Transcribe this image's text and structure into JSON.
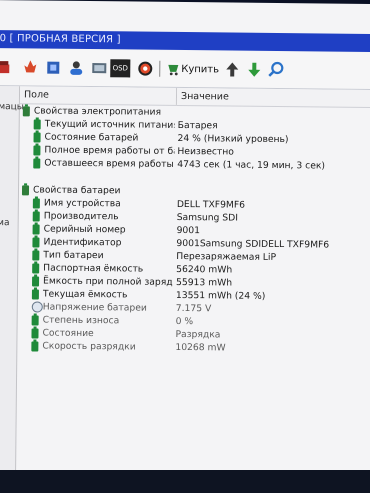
{
  "window": {
    "title": "[ ПРОБНАЯ ВЕРСИЯ ]",
    "title_prefix": "0"
  },
  "toolbar": {
    "buy_label": "Купить",
    "icons": [
      "report-icon",
      "flame-icon",
      "benchmark-icon",
      "user-icon",
      "module-icon",
      "osd-icon",
      "gauge-icon",
      "cart-icon",
      "up-arrow-icon",
      "down-arrow-icon",
      "search-icon"
    ],
    "osd_text": "OSD"
  },
  "left_pane": {
    "items": [
      "омацы",
      "ема"
    ]
  },
  "columns": {
    "field": "Поле",
    "value": "Значение"
  },
  "power_section": {
    "title": "Свойства электропитания",
    "rows": [
      {
        "field": "Текущий источник питания",
        "value": "Батарея"
      },
      {
        "field": "Состояние батарей",
        "value": "24 % (Низкий уровень)"
      },
      {
        "field": "Полное время работы от бата...",
        "value": "Неизвестно"
      },
      {
        "field": "Оставшееся время работы от ...",
        "value": "4743 сек (1 час, 19 мин, 3 сек)"
      }
    ]
  },
  "battery_section": {
    "title": "Свойства батареи",
    "rows": [
      {
        "field": "Имя устройства",
        "value": "DELL TXF9MF6"
      },
      {
        "field": "Производитель",
        "value": "Samsung SDI"
      },
      {
        "field": "Серийный номер",
        "value": "9001"
      },
      {
        "field": "Идентификатор",
        "value": "9001Samsung SDIDELL TXF9MF6"
      },
      {
        "field": "Тип батареи",
        "value": "Перезаряжаемая LiP"
      },
      {
        "field": "Паспортная ёмкость",
        "value": "56240 mWh"
      },
      {
        "field": "Ёмкость при полной зарядке",
        "value": "55913 mWh"
      },
      {
        "field": "Текущая ёмкость",
        "value": "13551 mWh  (24 %)"
      },
      {
        "field": "Напряжение батареи",
        "value": "7.175 V"
      },
      {
        "field": "Степень износа",
        "value": "0 %"
      },
      {
        "field": "Состояние",
        "value": "Разрядка"
      },
      {
        "field": "Скорость разрядки",
        "value": "10268 mW"
      }
    ]
  },
  "colors": {
    "titlebar": "#1f3fc4",
    "battery_icon": "#1f8a3a",
    "pane_background": "#f4f4f6"
  }
}
